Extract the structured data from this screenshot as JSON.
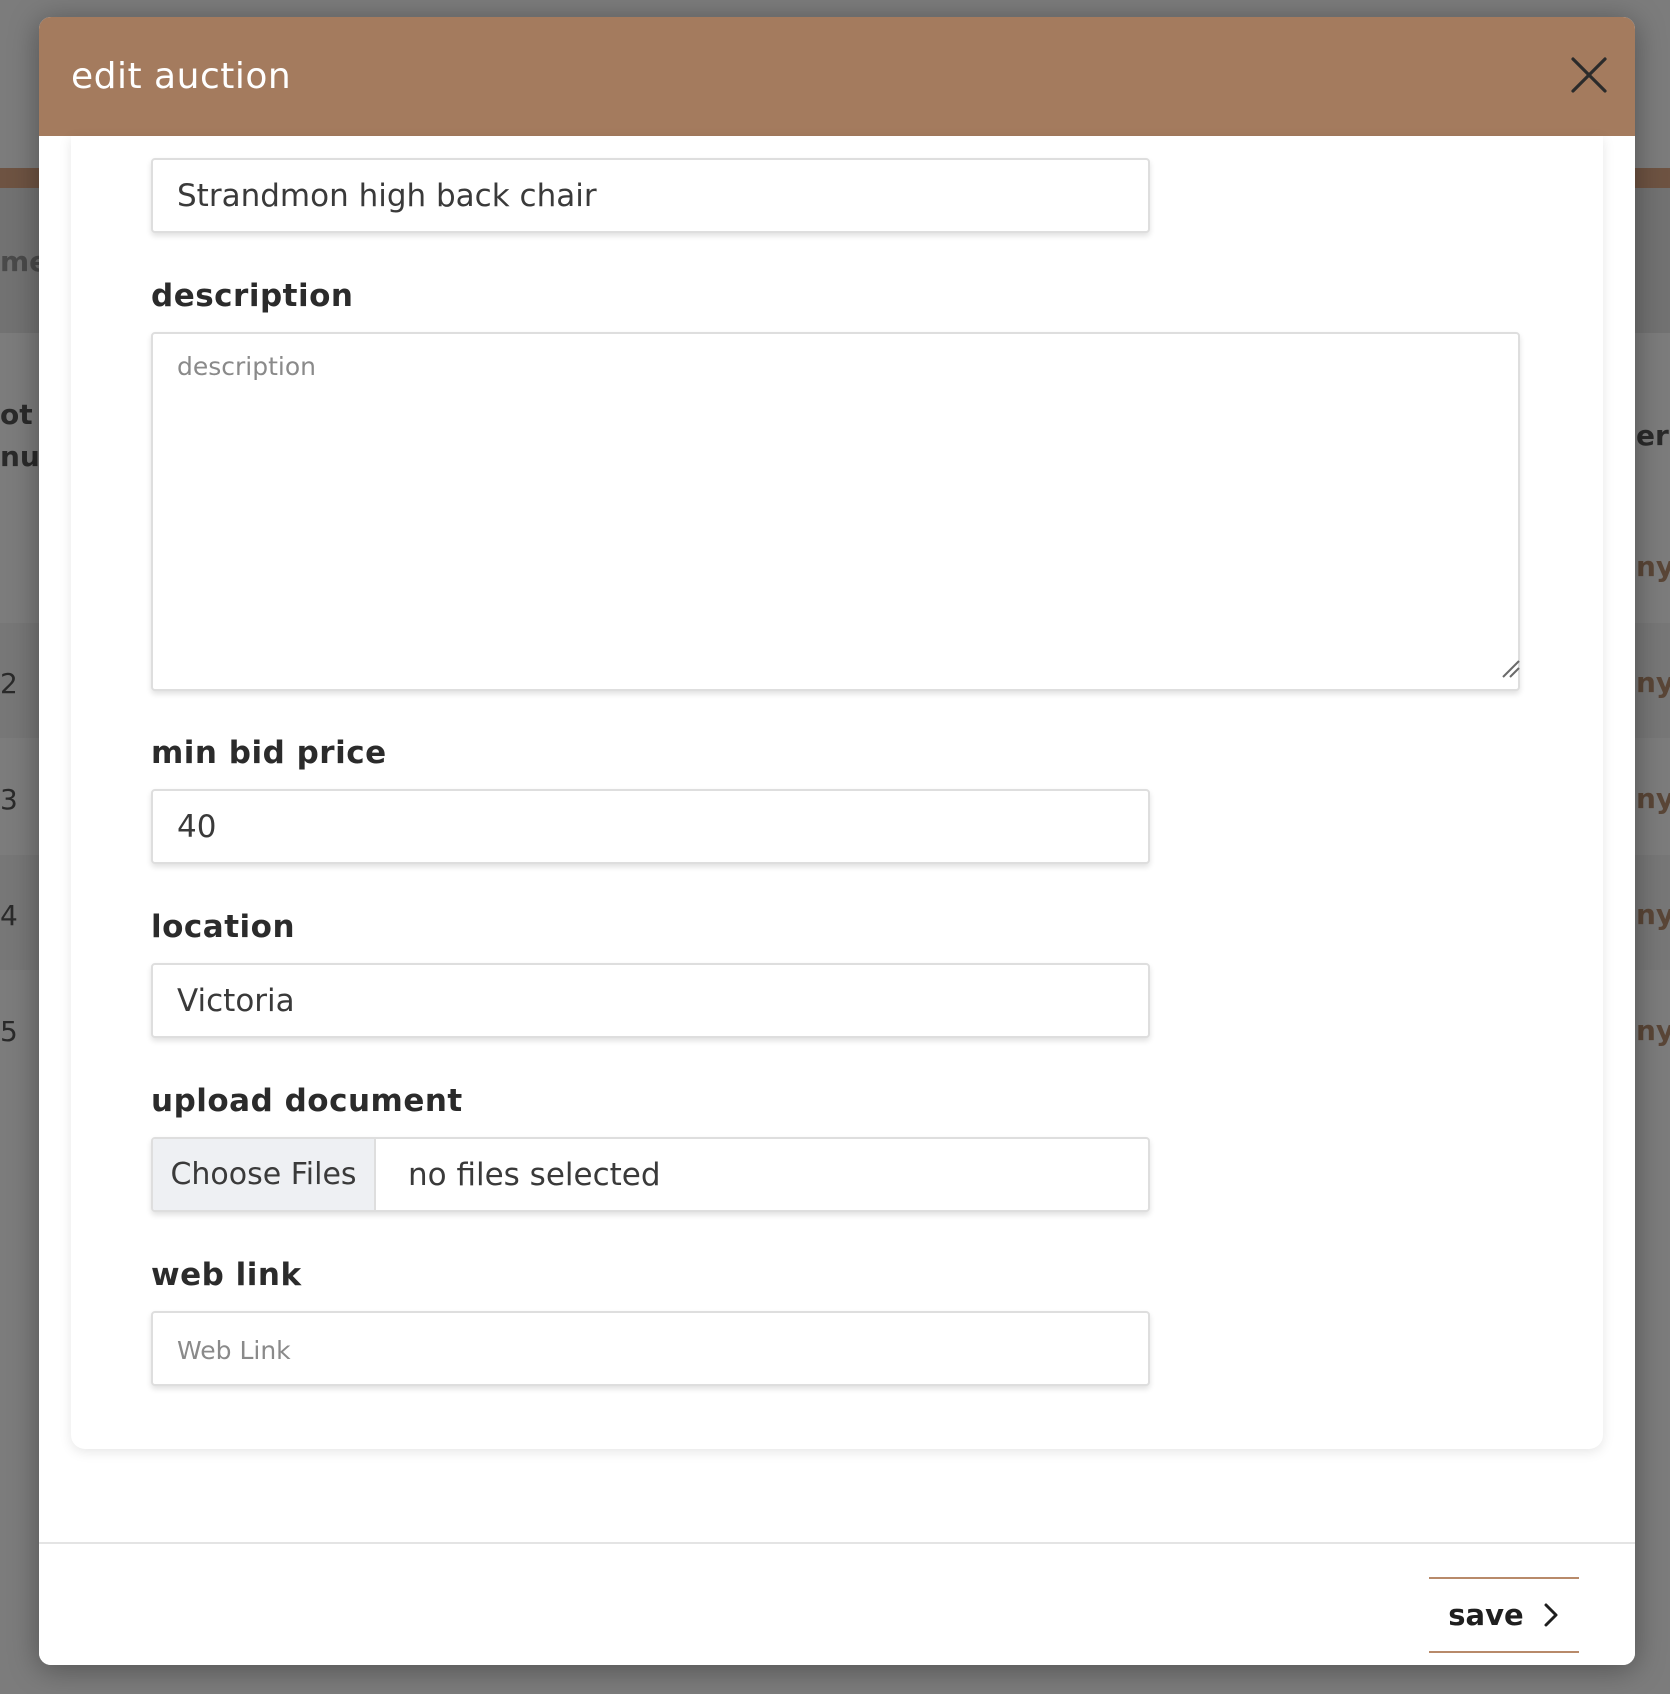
{
  "background": {
    "fragments": [
      "me",
      "ot",
      "nur",
      "2",
      "3",
      "4",
      "5",
      "er",
      "ny",
      "ny",
      "ny",
      "ny",
      "ny"
    ]
  },
  "modal": {
    "title": "edit auction",
    "close_icon": "close-icon",
    "fields": {
      "name": {
        "value": "Strandmon high back chair"
      },
      "description": {
        "label": "description",
        "placeholder": "description",
        "value": ""
      },
      "min_bid_price": {
        "label": "min bid price",
        "value": "40"
      },
      "location": {
        "label": "location",
        "value": "Victoria"
      },
      "upload_document": {
        "label": "upload document",
        "button_label": "Choose Files",
        "status": "no files selected"
      },
      "web_link": {
        "label": "web link",
        "placeholder": "Web Link",
        "value": ""
      }
    },
    "footer": {
      "save_label": "save",
      "save_icon": "chevron-right-icon"
    }
  },
  "colors": {
    "header": "#a47b5e",
    "accent": "#b88a6a",
    "overlay": "#7c7c7c"
  }
}
